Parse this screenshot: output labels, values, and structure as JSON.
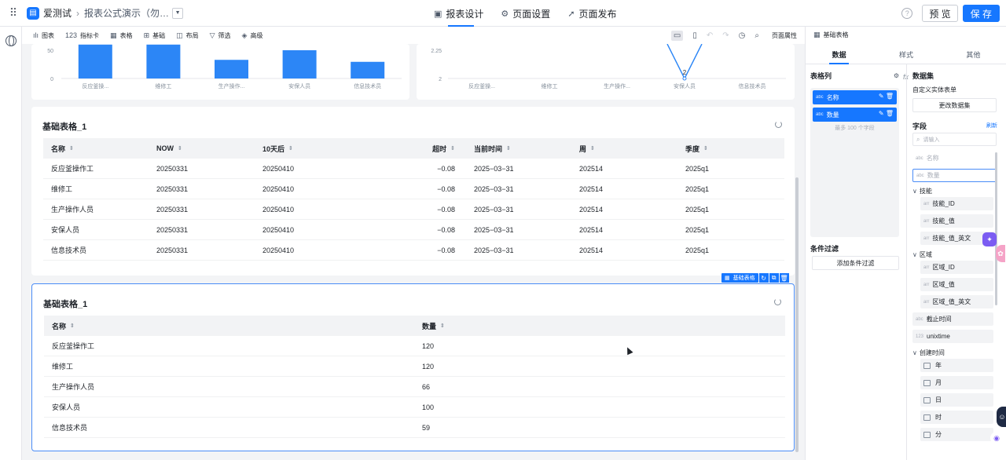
{
  "app": {
    "name": "爱测试",
    "breadcrumb": "报表公式演示（勿…"
  },
  "top_tabs": [
    {
      "label": "报表设计",
      "icon": "▣"
    },
    {
      "label": "页面设置",
      "icon": "⚙"
    },
    {
      "label": "页面发布",
      "icon": "➚"
    }
  ],
  "top_right": {
    "preview": "预 览",
    "save": "保 存"
  },
  "toolbar": {
    "items": [
      {
        "label": "图表",
        "icon": "ılı"
      },
      {
        "label": "指标卡",
        "icon": "123"
      },
      {
        "label": "表格",
        "icon": "▦"
      },
      {
        "label": "基础",
        "icon": "⊞"
      },
      {
        "label": "布局",
        "icon": "◫"
      },
      {
        "label": "筛选",
        "icon": "▽"
      },
      {
        "label": "高级",
        "icon": "◈"
      }
    ],
    "page_props": "页面属性"
  },
  "chart_data": [
    {
      "type": "bar",
      "categories": [
        "反应釜操...",
        "维修工",
        "生产操作...",
        "安保人员",
        "信息技术员"
      ],
      "values": [
        120,
        120,
        66,
        100,
        59
      ],
      "ylim": [
        0,
        130
      ],
      "y_ticks_visible": [
        "50",
        "0"
      ],
      "bar_labels_visible": [
        "59"
      ],
      "colors": {
        "bar": "#2c86f6"
      }
    },
    {
      "type": "line",
      "categories": [
        "反应釜操...",
        "维修工",
        "生产操作...",
        "安保人员",
        "信息技术员"
      ],
      "y_ticks_visible": [
        "2.25",
        "2"
      ],
      "point_label": "2",
      "colors": {
        "line": "#2c86f6"
      }
    }
  ],
  "table1": {
    "title": "基础表格_1",
    "columns": [
      "名称",
      "NOW",
      "10天后",
      "超时",
      "当前时间",
      "周",
      "季度"
    ],
    "rows": [
      [
        "反应釜操作工",
        "20250331",
        "20250410",
        "−0.08",
        "2025−03−31",
        "202514",
        "2025q1"
      ],
      [
        "维修工",
        "20250331",
        "20250410",
        "−0.08",
        "2025−03−31",
        "202514",
        "2025q1"
      ],
      [
        "生产操作人员",
        "20250331",
        "20250410",
        "−0.08",
        "2025−03−31",
        "202514",
        "2025q1"
      ],
      [
        "安保人员",
        "20250331",
        "20250410",
        "−0.08",
        "2025−03−31",
        "202514",
        "2025q1"
      ],
      [
        "信息技术员",
        "20250331",
        "20250410",
        "−0.08",
        "2025−03−31",
        "202514",
        "2025q1"
      ]
    ]
  },
  "table2": {
    "title": "基础表格_1",
    "columns": [
      "名称",
      "数量"
    ],
    "rows": [
      [
        "反应釜操作工",
        "120"
      ],
      [
        "维修工",
        "120"
      ],
      [
        "生产操作人员",
        "66"
      ],
      [
        "安保人员",
        "100"
      ],
      [
        "信息技术员",
        "59"
      ]
    ]
  },
  "selection_toolbar": {
    "label": "基础表格"
  },
  "right_panel": {
    "title": "基础表格",
    "tabs": [
      "数据",
      "样式",
      "其他"
    ],
    "columns_header": "表格列",
    "columns": [
      {
        "type": "abc",
        "name": "名称"
      },
      {
        "type": "abc",
        "name": "数量"
      }
    ],
    "max_hint": "最多 100 个字段",
    "filter_header": "条件过滤",
    "add_filter": "添加条件过滤",
    "dataset_header": "数据集",
    "dataset_name": "自定义实体表单",
    "change_dataset": "更改数据集",
    "fields_header": "字段",
    "refresh": "刷新",
    "search_placeholder": "请输入",
    "fields": {
      "name": {
        "type": "abc",
        "label": "名称"
      },
      "qty": {
        "type": "abc",
        "label": "数量"
      },
      "skill_group": "技能",
      "skill_items": [
        {
          "type": "arr",
          "label": "技能_ID"
        },
        {
          "type": "arr",
          "label": "技能_值"
        },
        {
          "type": "arr",
          "label": "技能_值_英文"
        }
      ],
      "region_group": "区域",
      "region_items": [
        {
          "type": "arr",
          "label": "区域_ID"
        },
        {
          "type": "arr",
          "label": "区域_值"
        },
        {
          "type": "arr",
          "label": "区域_值_英文"
        }
      ],
      "deadline": {
        "type": "abc",
        "label": "截止时间"
      },
      "unixtime": {
        "type": "123",
        "label": "unixtime"
      },
      "created_group": "创建时间",
      "created_items": [
        "年",
        "月",
        "日",
        "时",
        "分"
      ]
    }
  }
}
